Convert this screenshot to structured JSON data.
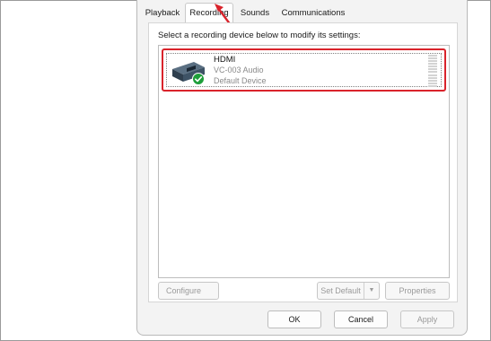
{
  "tabs": [
    {
      "label": "Playback"
    },
    {
      "label": "Recording"
    },
    {
      "label": "Sounds"
    },
    {
      "label": "Communications"
    }
  ],
  "active_tab": "Recording",
  "instruction": "Select a recording device below to modify its settings:",
  "devices": [
    {
      "name": "HDMI",
      "description": "VC-003 Audio",
      "status": "Default Device",
      "icon": "hdmi-device-icon",
      "default_badge": "check-badge-icon",
      "selected": true
    }
  ],
  "buttons": {
    "configure": "Configure",
    "set_default": "Set Default",
    "set_default_arrow": "▼",
    "properties": "Properties",
    "ok": "OK",
    "cancel": "Cancel",
    "apply": "Apply"
  },
  "colors": {
    "highlight": "#d9232b",
    "badge": "#1e9e3a"
  }
}
